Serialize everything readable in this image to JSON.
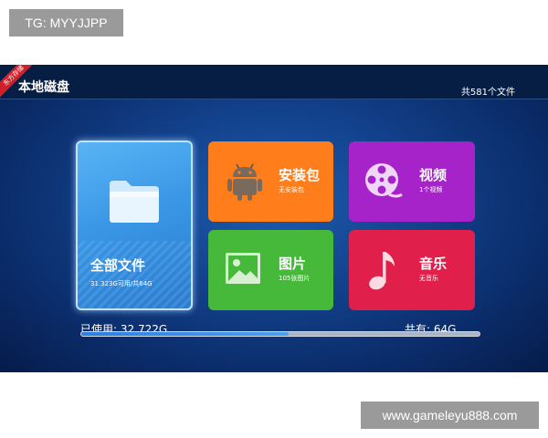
{
  "watermarks": {
    "top": "TG: MYYJJPP",
    "bottom": "www.gameleyu888.com"
  },
  "header": {
    "ribbon": "东方存储",
    "title": "本地磁盘",
    "file_count": "共581个文件"
  },
  "tiles": {
    "all_files": {
      "label": "全部文件",
      "sub": "31.323G可用/共64G",
      "icon": "folder-icon"
    },
    "apk": {
      "label": "安装包",
      "sub": "无安装包",
      "icon": "android-icon"
    },
    "video": {
      "label": "视频",
      "sub": "1个视频",
      "icon": "film-reel-icon"
    },
    "pictures": {
      "label": "图片",
      "sub": "105张图片",
      "icon": "image-icon"
    },
    "music": {
      "label": "音乐",
      "sub": "无音乐",
      "icon": "music-note-icon"
    }
  },
  "storage": {
    "used_label": "已使用: 32.722G",
    "total_label": "共有: 64G",
    "used_fraction": 0.52
  },
  "colors": {
    "apk": "#ff7d1a",
    "video": "#a523c8",
    "pictures": "#46b83a",
    "music": "#e0204a",
    "all_files": "#3a97e6"
  }
}
